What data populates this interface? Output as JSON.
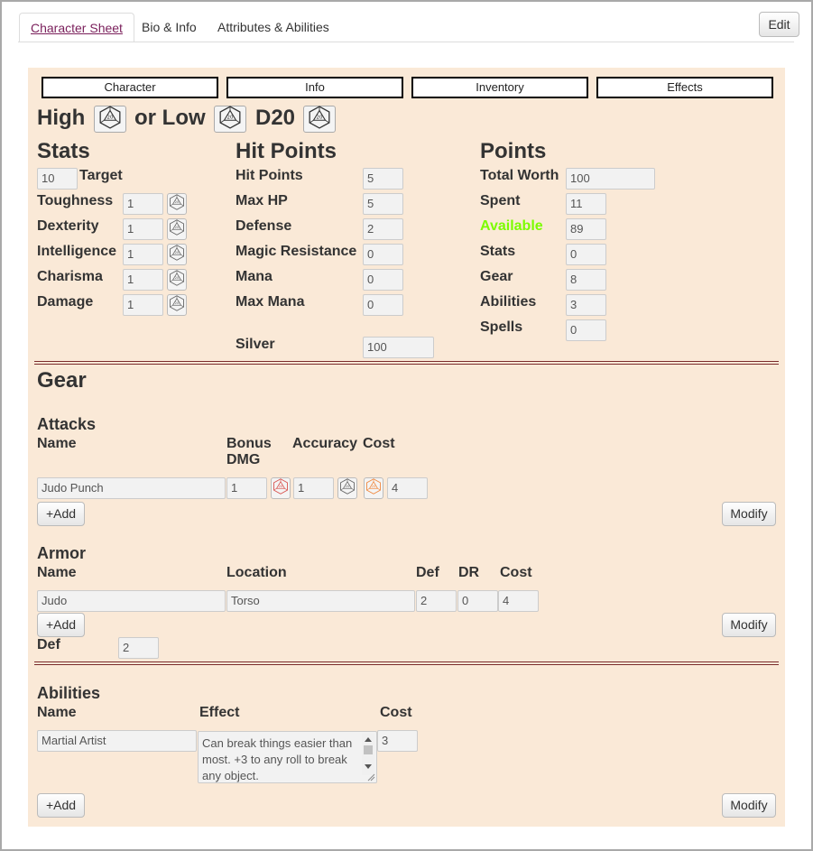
{
  "tabs": [
    {
      "label": "Character Sheet"
    },
    {
      "label": "Bio & Info"
    },
    {
      "label": "Attributes & Abilities"
    }
  ],
  "edit_label": "Edit",
  "nav": [
    "Character",
    "Info",
    "Inventory",
    "Effects"
  ],
  "roll": {
    "high": "High",
    "or_low": "or Low",
    "d20": "D20"
  },
  "stats": {
    "title": "Stats",
    "target_value": "10",
    "target_label": "Target",
    "rows": [
      {
        "label": "Toughness",
        "value": "1"
      },
      {
        "label": "Dexterity",
        "value": "1"
      },
      {
        "label": "Intelligence",
        "value": "1"
      },
      {
        "label": "Charisma",
        "value": "1"
      },
      {
        "label": "Damage",
        "value": "1"
      }
    ]
  },
  "hitpoints": {
    "title": "Hit Points",
    "rows": [
      {
        "label": "Hit Points",
        "value": "5"
      },
      {
        "label": "Max HP",
        "value": "5"
      },
      {
        "label": "Defense",
        "value": "2"
      },
      {
        "label": "Magic Resistance",
        "value": "0"
      },
      {
        "label": "Mana",
        "value": "0"
      },
      {
        "label": "Max Mana",
        "value": "0"
      }
    ],
    "silver_label": "Silver",
    "silver_value": "100"
  },
  "points": {
    "title": "Points",
    "rows": [
      {
        "label": "Total Worth",
        "value": "100"
      },
      {
        "label": "Spent",
        "value": "11"
      },
      {
        "label": "Available",
        "value": "89"
      },
      {
        "label": "Stats",
        "value": "0"
      },
      {
        "label": "Gear",
        "value": "8"
      },
      {
        "label": "Abilities",
        "value": "3"
      },
      {
        "label": "Spells",
        "value": "0"
      }
    ]
  },
  "gear": {
    "title": "Gear",
    "attacks": {
      "title": "Attacks",
      "headers": {
        "name": "Name",
        "bonus": "Bonus\nDMG",
        "accuracy": "Accuracy",
        "cost": "Cost"
      },
      "row": {
        "name": "Judo Punch",
        "bonus": "1",
        "accuracy": "1",
        "cost": "4"
      }
    },
    "armor": {
      "title": "Armor",
      "headers": {
        "name": "Name",
        "location": "Location",
        "def": "Def",
        "dr": "DR",
        "cost": "Cost"
      },
      "row": {
        "name": "Judo",
        "location": "Torso",
        "def": "2",
        "dr": "0",
        "cost": "4"
      },
      "total_label": "Def",
      "total_value": "2"
    }
  },
  "abilities": {
    "title": "Abilities",
    "headers": {
      "name": "Name",
      "effect": "Effect",
      "cost": "Cost"
    },
    "row": {
      "name": "Martial Artist",
      "effect": "Can break things easier than most. +3 to any roll to break any object.",
      "cost": "3"
    }
  },
  "buttons": {
    "add": "+Add",
    "modify": "Modify"
  },
  "colors": {
    "sheet_bg": "#fae9d7",
    "available": "#7cfc00",
    "active_tab": "#7a1f5b"
  }
}
